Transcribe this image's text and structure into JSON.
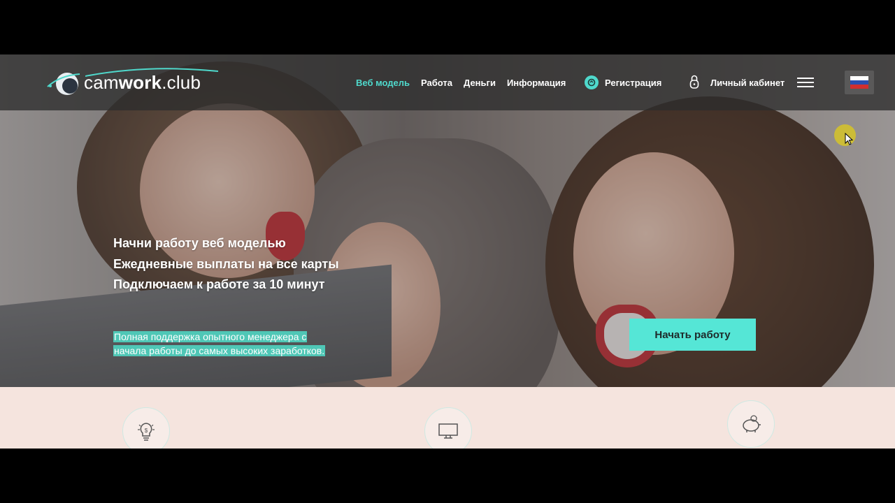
{
  "header": {
    "logo_prefix": "cam",
    "logo_bold": "work",
    "logo_suffix": ".club",
    "nav": [
      {
        "label": "Веб модель",
        "active": true
      },
      {
        "label": "Работа",
        "active": false
      },
      {
        "label": "Деньги",
        "active": false
      },
      {
        "label": "Информация",
        "active": false
      }
    ],
    "register_label": "Регистрация",
    "cabinet_label": "Личный кабинет",
    "language_icon": "flag-russia-icon"
  },
  "hero": {
    "lines": [
      "Начни работу веб моделью",
      "Ежедневные выплаты на все карты",
      "Подключаем к работе за 10 минут"
    ],
    "sub_line1": "Полная поддержка опытного менеджера с",
    "sub_line2": "начала работы до самых высоких заработков.",
    "cta_label": "Начать работу"
  },
  "features": {
    "icons": [
      "lightbulb-dollar-icon",
      "monitor-icon",
      "piggy-bank-icon"
    ]
  },
  "colors": {
    "accent": "#4fd9cc",
    "cta_bg": "#55e6d6",
    "highlight": "#4fc7b6",
    "header_bg": "#2d2d2d",
    "band_bg": "#f5e4de"
  }
}
